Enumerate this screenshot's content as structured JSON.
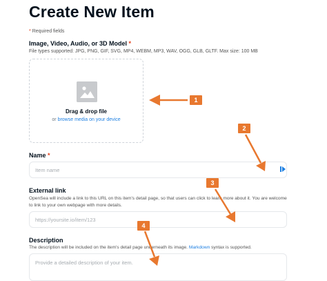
{
  "page": {
    "title": "Create New Item",
    "required_note": "Required fields"
  },
  "media": {
    "label": "Image, Video, Audio, or 3D Model",
    "file_types": "File types supported: JPG, PNG, GIF, SVG, MP4, WEBM, MP3, WAV, OGG, GLB, GLTF. Max size: 100 MB",
    "drag_text": "Drag & drop file",
    "or_text": "or",
    "browse_link": "browse media on your device"
  },
  "name_field": {
    "label": "Name",
    "placeholder": "Item name"
  },
  "external_link": {
    "label": "External link",
    "help": "OpenSea will include a link to this URL on this item's detail page, so that users can click to learn more about it. You are welcome to link to your own webpage with more details.",
    "placeholder": "https://yoursite.io/item/123"
  },
  "description": {
    "label": "Description",
    "help_prefix": "The description will be included on the item's detail page underneath its image.",
    "help_link": "Markdown",
    "help_suffix": "syntax is supported.",
    "placeholder": "Provide a detailed description of your item."
  },
  "annotations": {
    "color": "#e8782f",
    "badges": [
      "1",
      "2",
      "3",
      "4"
    ]
  },
  "icons": {
    "image_placeholder": "image-icon",
    "name_field_icon": "field-action-icon"
  }
}
